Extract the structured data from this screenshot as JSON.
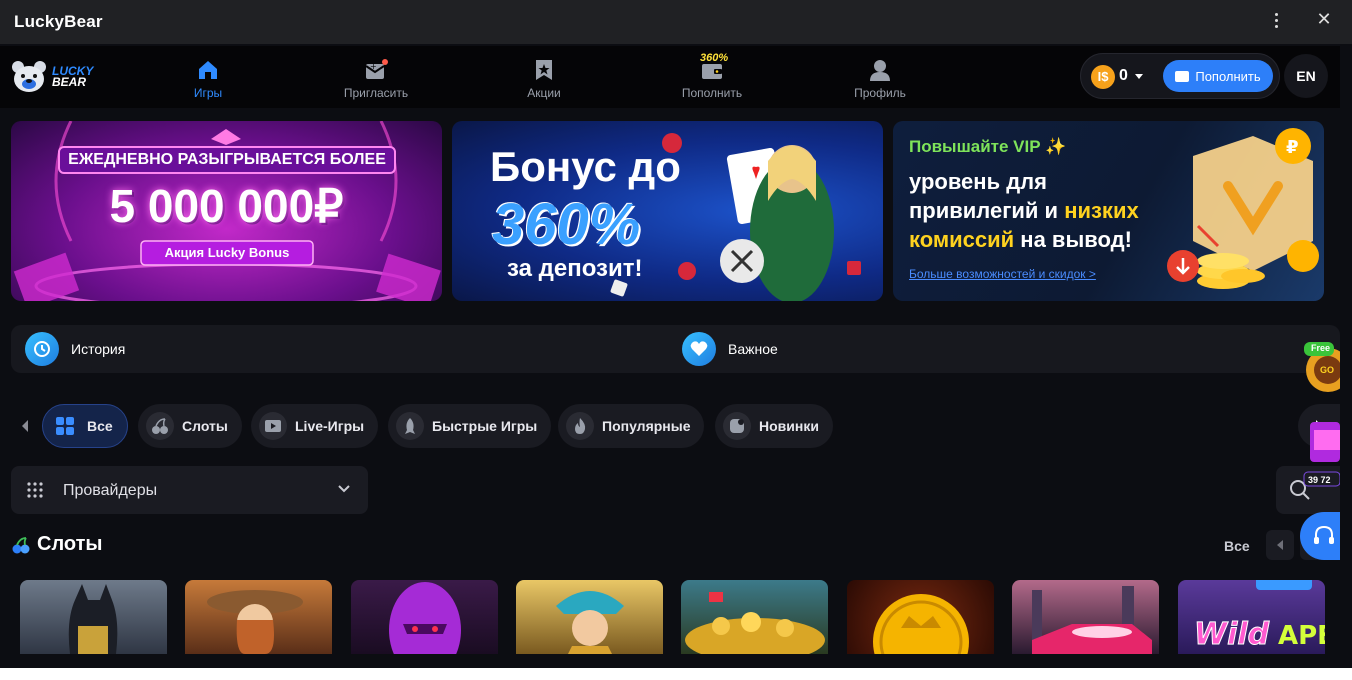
{
  "window": {
    "title": "LuckyBear",
    "close_glyph": "✕"
  },
  "logo": {
    "line1": "LUCKY",
    "line2": "BEAR"
  },
  "nav": {
    "items": [
      {
        "label": "Игры",
        "icon": "home-icon"
      },
      {
        "label": "Пригласить",
        "icon": "invite-icon"
      },
      {
        "label": "Акции",
        "icon": "star-icon"
      },
      {
        "label": "Пополнить",
        "icon": "wallet-icon",
        "badge": "360%"
      },
      {
        "label": "Профиль",
        "icon": "profile-icon"
      }
    ]
  },
  "wallet": {
    "coin_symbol": "І$",
    "balance": "0",
    "topup_label": "Пополнить"
  },
  "lang": "EN",
  "banners": [
    {
      "line1": "ЕЖЕДНЕВНО РАЗЫГРЫВАЕТСЯ БОЛЕЕ",
      "amount": "5 000 000₽",
      "tag": "Акция Lucky Bonus"
    },
    {
      "line1": "Бонус до",
      "percent": "360%",
      "line3": "за депозит!"
    },
    {
      "head": "Повышайте VIP ✨",
      "line1": "уровень для",
      "line2a": "привилегий и ",
      "line2b": "низких",
      "line3a": "комиссий",
      "line3b": " на вывод!",
      "link": "Больше возможностей и скидок >"
    }
  ],
  "quick": {
    "history": "История",
    "important": "Важное"
  },
  "categories": [
    {
      "label": "Все",
      "icon": "grid-icon"
    },
    {
      "label": "Слоты",
      "icon": "cherry-icon"
    },
    {
      "label": "Live-Игры",
      "icon": "play-icon"
    },
    {
      "label": "Быстрые Игры",
      "icon": "rocket-icon"
    },
    {
      "label": "Популярные",
      "icon": "flame-icon"
    },
    {
      "label": "Новинки",
      "icon": "new-icon"
    }
  ],
  "providers": {
    "label": "Провайдеры"
  },
  "slots": {
    "title": "Слоты",
    "all_label": "Все"
  },
  "side": {
    "free_label": "Free",
    "go_label": "GO",
    "jackpot": "39 72"
  },
  "colors": {
    "accent": "#2d7ff9",
    "background": "#0c0d12",
    "panel": "#1a1b22",
    "vip_green": "#7ee35a",
    "vip_yellow": "#ffd21f"
  }
}
